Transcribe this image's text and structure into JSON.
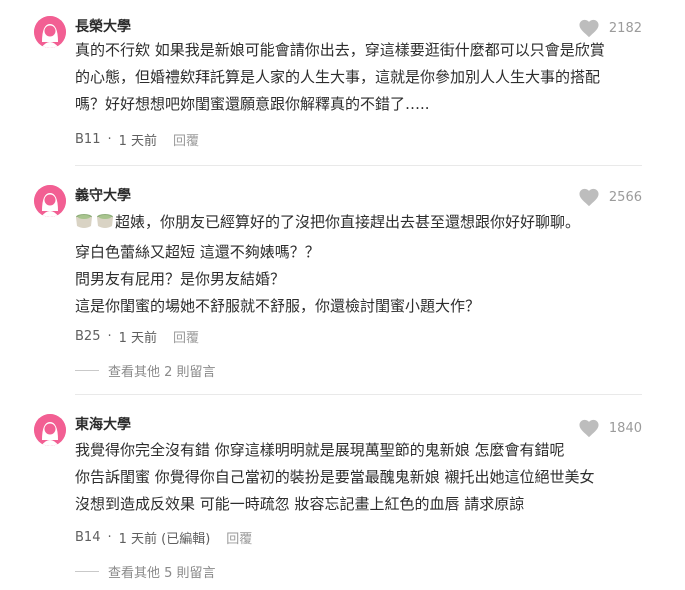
{
  "comments": [
    {
      "school": "長榮大學",
      "likes": "2182",
      "lines": [
        "真的不行欸 如果我是新娘可能會請你出去，穿這樣要逛街什麼都可以只會是欣賞",
        "的心態，但婚禮欸拜託算是人家的人生大事，這就是你參加別人人生大事的搭配",
        "嗎？好好想想吧妳閨蜜還願意跟你解釋真的不錯了….."
      ],
      "floor": "B11",
      "time": "1 天前",
      "reply_label": "回覆"
    },
    {
      "school": "義守大學",
      "likes": "2566",
      "lines": [
        "超婊，你朋友已經算好的了沒把你直接趕出去甚至還想跟你好好聊聊。",
        "穿白色蕾絲又超短 這還不夠婊嗎？？",
        "問男友有屁用？是你男友結婚？",
        "這是你閨蜜的場她不舒服就不舒服，你還檢討閨蜜小題大作？"
      ],
      "floor": "B25",
      "time": "1 天前",
      "reply_label": "回覆",
      "more_replies": "查看其他 2 則留言"
    },
    {
      "school": "東海大學",
      "likes": "1840",
      "lines": [
        "我覺得你完全沒有錯 你穿這樣明明就是展現萬聖節的鬼新娘 怎麼會有錯呢",
        "你告訴閨蜜 你覺得你自己當初的裝扮是要當最醜鬼新娘 襯托出她這位絕世美女",
        "沒想到造成反效果 可能一時疏忽 妝容忘記畫上紅色的血唇 請求原諒"
      ],
      "floor": "B14",
      "time": "1 天前 (已編輯)",
      "reply_label": "回覆",
      "more_replies": "查看其他 5 則留言"
    }
  ],
  "icons": {
    "avatar": "female-avatar-icon",
    "like": "heart-icon",
    "emoji": "teacup-emoji"
  },
  "colors": {
    "avatar_bg": "#f25f93",
    "heart": "#bdbdbd"
  }
}
